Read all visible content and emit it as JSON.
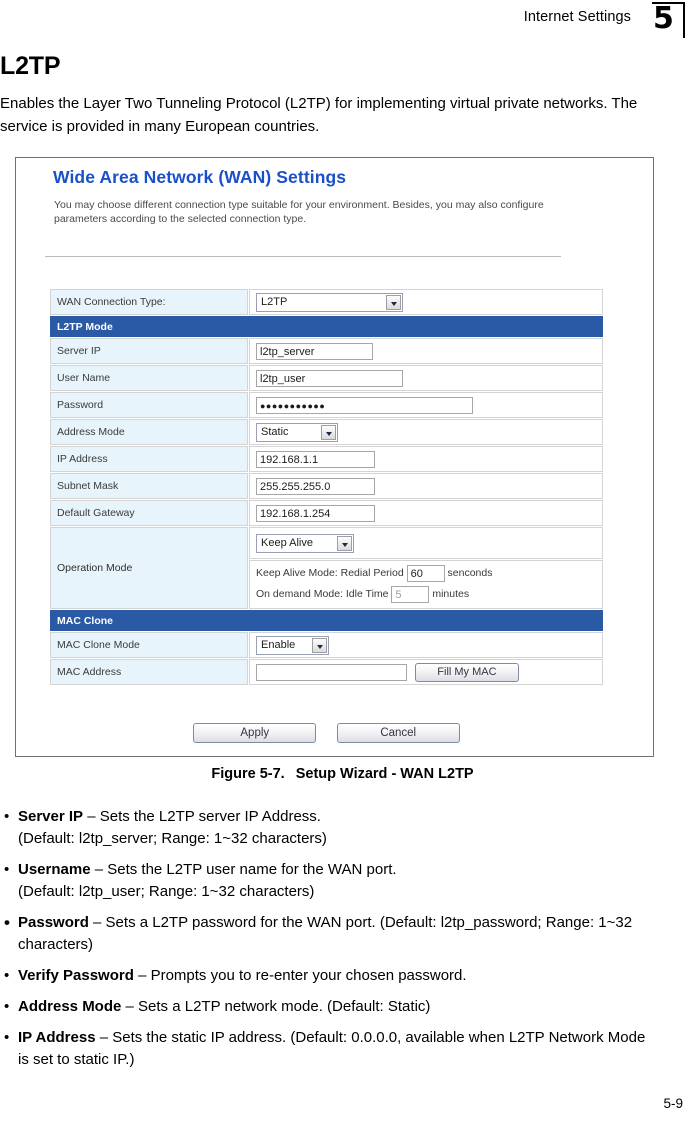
{
  "header": {
    "running_title": "Internet Settings",
    "chapter_number": "5"
  },
  "page": {
    "section_title": "L2TP",
    "intro": "Enables the Layer Two Tunneling Protocol (L2TP) for implementing virtual private networks. The service is provided in many European countries.",
    "folio": "5-9"
  },
  "figure": {
    "caption_label": "Figure 5-7.",
    "caption_text": "Setup Wizard - WAN L2TP"
  },
  "screenshot": {
    "title": "Wide Area Network (WAN) Settings",
    "description": "You may choose different connection type suitable for your environment. Besides, you may also configure parameters according to the selected connection type.",
    "accent_color": "#1a50c8",
    "section_header_color": "#2a5aa5",
    "label_cell_color": "#e8f4fb",
    "wan_connection": {
      "label": "WAN Connection Type:",
      "value": "L2TP"
    },
    "l2tp_section": {
      "title": "L2TP Mode",
      "rows": [
        {
          "label": "Server IP",
          "value": "l2tp_server",
          "widget": "text"
        },
        {
          "label": "User Name",
          "value": "l2tp_user",
          "widget": "text"
        },
        {
          "label": "Password",
          "value": "●●●●●●●●●●●",
          "widget": "password"
        },
        {
          "label": "Address Mode",
          "value": "Static",
          "widget": "select"
        },
        {
          "label": "IP Address",
          "value": "192.168.1.1",
          "widget": "text"
        },
        {
          "label": "Subnet Mask",
          "value": "255.255.255.0",
          "widget": "text"
        },
        {
          "label": "Default Gateway",
          "value": "192.168.1.254",
          "widget": "text"
        }
      ]
    },
    "operation_mode": {
      "label": "Operation Mode",
      "select_value": "Keep Alive",
      "keep_alive_prefix": "Keep Alive Mode: Redial Period",
      "keep_alive_value": "60",
      "keep_alive_unit": "senconds",
      "on_demand_prefix": "On demand Mode: Idle Time",
      "on_demand_value": "5",
      "on_demand_unit": "minutes"
    },
    "mac_clone": {
      "title": "MAC Clone",
      "mode_label": "MAC Clone Mode",
      "mode_value": "Enable",
      "address_label": "MAC Address",
      "address_value": "",
      "fill_button": "Fill My MAC"
    },
    "buttons": {
      "apply": "Apply",
      "cancel": "Cancel"
    }
  },
  "bullets": [
    {
      "marker": "•",
      "bold": "Server IP",
      "rest": " – Sets the L2TP server IP Address.",
      "line2": "(Default: l2tp_server; Range: 1~32 characters)",
      "style": "round"
    },
    {
      "marker": "•",
      "bold": "Username",
      "rest": " – Sets the L2TP user name for the WAN port.",
      "line2": "(Default: l2tp_user; Range: 1~32 characters)",
      "style": "round"
    },
    {
      "marker": "•",
      "bold": "Password",
      "rest": " – Sets a L2TP password for the WAN port. (Default: l2tp_password; Range: 1~32 characters)",
      "line2": "",
      "style": "square"
    },
    {
      "marker": "•",
      "bold": "Verify Password",
      "rest": " – Prompts you to re-enter your chosen password.",
      "line2": "",
      "style": "round"
    },
    {
      "marker": "•",
      "bold": "Address Mode",
      "rest": " – Sets a L2TP network mode. (Default: Static)",
      "line2": "",
      "style": "round"
    },
    {
      "marker": "•",
      "bold": "IP Address",
      "rest": " – Sets the static IP address. (Default: 0.0.0.0, available when L2TP Network Mode is set to static IP.)",
      "line2": "",
      "style": "round"
    }
  ]
}
